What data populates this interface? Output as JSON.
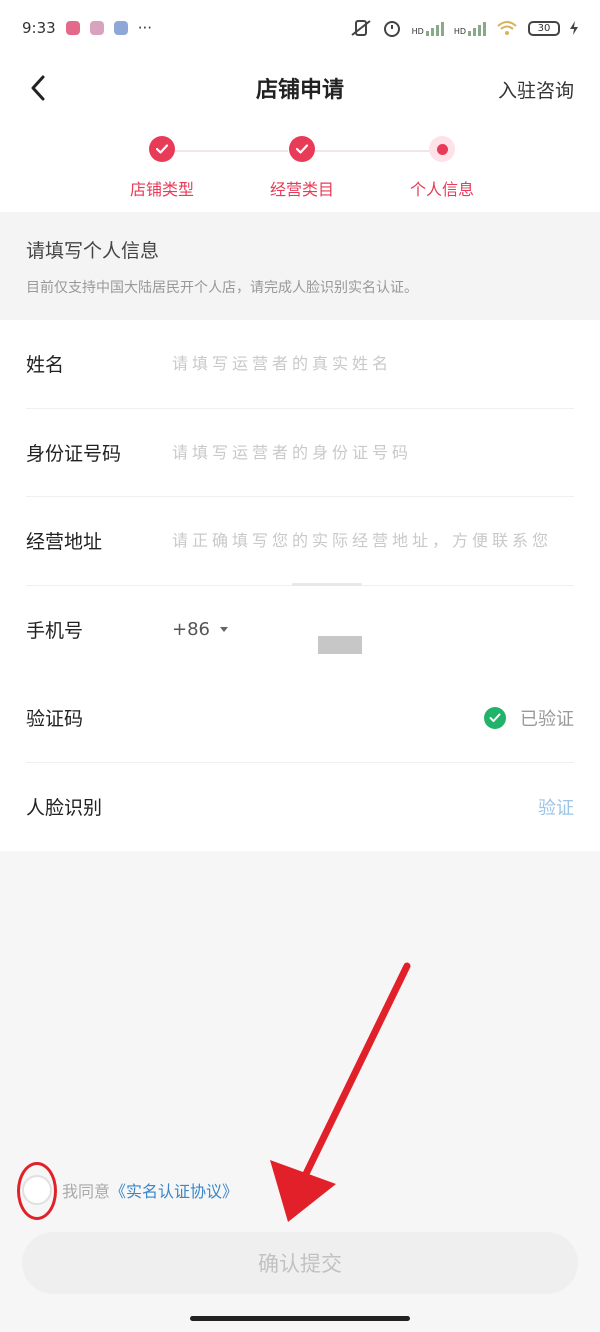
{
  "status_bar": {
    "time": "9:33",
    "more": "···",
    "hd1": "HD",
    "hd2": "HD",
    "battery": "30"
  },
  "header": {
    "title": "店铺申请",
    "consult": "入驻咨询"
  },
  "steps": [
    {
      "label": "店铺类型",
      "state": "done"
    },
    {
      "label": "经营类目",
      "state": "done"
    },
    {
      "label": "个人信息",
      "state": "current"
    }
  ],
  "notice": {
    "title": "请填写个人信息",
    "desc": "目前仅支持中国大陆居民开个人店，请完成人脸识别实名认证。"
  },
  "form": {
    "name": {
      "label": "姓名",
      "placeholder": "请填写运营者的真实姓名"
    },
    "id_number": {
      "label": "身份证号码",
      "placeholder": "请填写运营者的身份证号码"
    },
    "address": {
      "label": "经营地址",
      "placeholder": "请正确填写您的实际经营地址，方便联系您"
    },
    "phone": {
      "label": "手机号",
      "country_code": "+86"
    },
    "code": {
      "label": "验证码",
      "status": "已验证"
    },
    "face": {
      "label": "人脸识别",
      "action": "验证"
    }
  },
  "agreement": {
    "prefix": "我同意",
    "link": "《实名认证协议》"
  },
  "submit_label": "确认提交",
  "colors": {
    "accent": "#e83b58",
    "verified": "#21b36a",
    "link": "#3a86c8",
    "annotation": "#e2202a"
  }
}
